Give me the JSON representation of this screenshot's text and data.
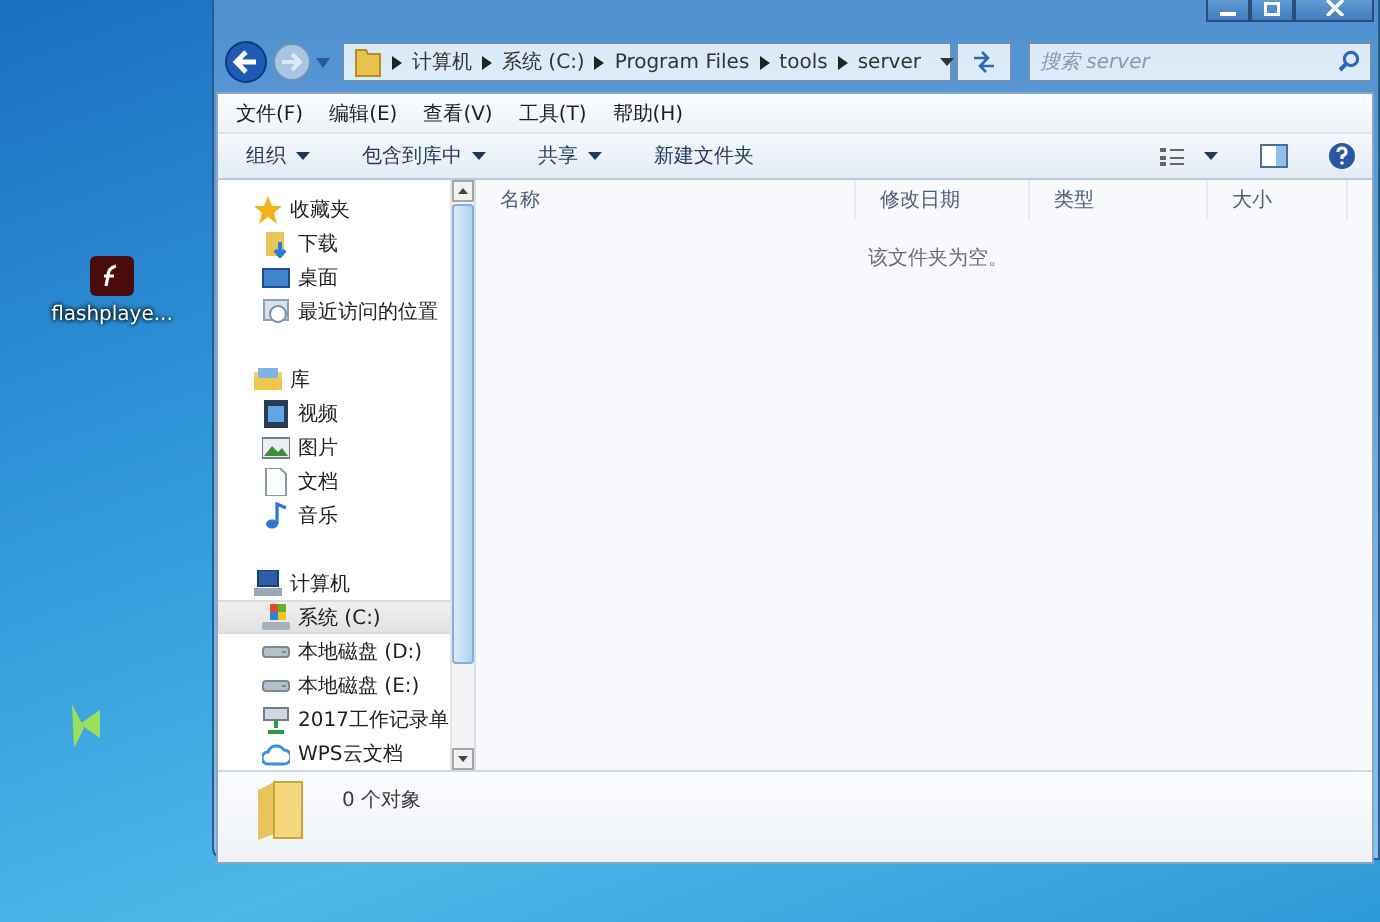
{
  "desktop": {
    "icons": [
      {
        "label": "flashplaye..."
      }
    ]
  },
  "window": {
    "caption_buttons": [
      {
        "kind": "minimize"
      },
      {
        "kind": "maximize"
      },
      {
        "kind": "close"
      }
    ]
  },
  "address_bar": {
    "crumbs": [
      "计算机",
      "系统 (C:)",
      "Program Files",
      "tools",
      "server"
    ]
  },
  "search": {
    "placeholder": "搜索 server"
  },
  "menu_bar": [
    "文件(F)",
    "编辑(E)",
    "查看(V)",
    "工具(T)",
    "帮助(H)"
  ],
  "toolbar": [
    {
      "label": "组织",
      "dropdown": true
    },
    {
      "label": "包含到库中",
      "dropdown": true
    },
    {
      "label": "共享",
      "dropdown": true
    },
    {
      "label": "新建文件夹",
      "dropdown": false
    }
  ],
  "sidebar": {
    "groups": [
      {
        "label": "收藏夹",
        "children": [
          {
            "label": "下载",
            "selected": false
          },
          {
            "label": "桌面",
            "selected": false
          },
          {
            "label": "最近访问的位置",
            "selected": false
          }
        ]
      },
      {
        "label": "库",
        "children": [
          {
            "label": "视频",
            "selected": false
          },
          {
            "label": "图片",
            "selected": false
          },
          {
            "label": "文档",
            "selected": false
          },
          {
            "label": "音乐",
            "selected": false
          }
        ]
      },
      {
        "label": "计算机",
        "children": [
          {
            "label": "系统 (C:)",
            "selected": true
          },
          {
            "label": "本地磁盘 (D:)",
            "selected": false
          },
          {
            "label": "本地磁盘 (E:)",
            "selected": false
          },
          {
            "label": "2017工作记录单",
            "selected": false
          },
          {
            "label": "WPS云文档",
            "selected": false
          }
        ]
      }
    ]
  },
  "file_list": {
    "columns": [
      "名称",
      "修改日期",
      "类型",
      "大小"
    ],
    "empty_message": "该文件夹为空。"
  },
  "status_bar": {
    "text": "0 个对象"
  }
}
